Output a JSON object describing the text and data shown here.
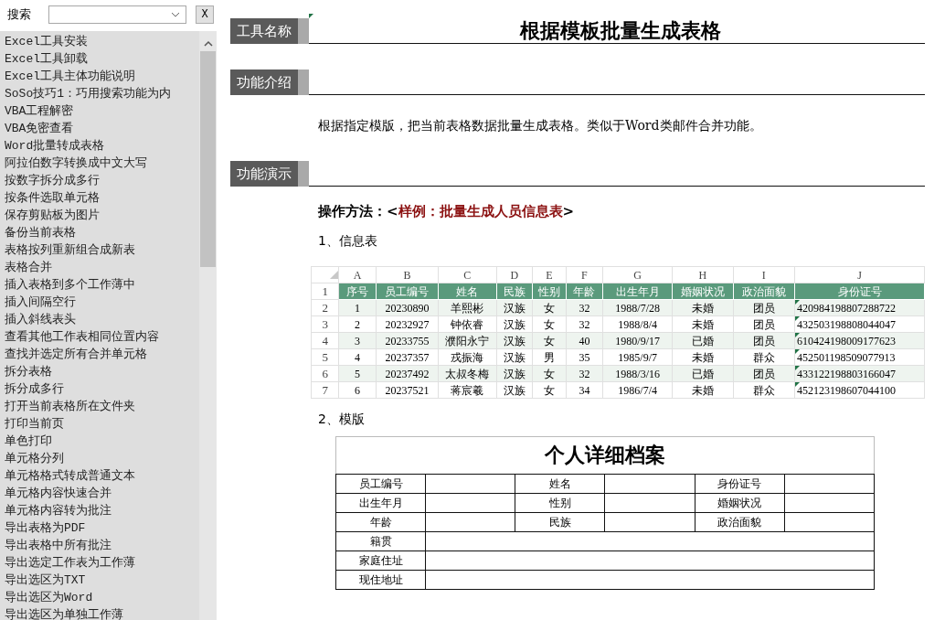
{
  "search": {
    "label": "搜索",
    "clear_button": "X"
  },
  "sidebar": {
    "items": [
      "Excel工具安装",
      "Excel工具卸载",
      "Excel工具主体功能说明",
      "SoSo技巧1：巧用搜索功能为内",
      "VBA工程解密",
      "VBA免密查看",
      "Word批量转成表格",
      "阿拉伯数字转换成中文大写",
      "按数字拆分成多行",
      "按条件选取单元格",
      "保存剪贴板为图片",
      "备份当前表格",
      "表格按列重新组合成新表",
      "表格合并",
      "插入表格到多个工作薄中",
      "插入间隔空行",
      "插入斜线表头",
      "查看其他工作表相同位置内容",
      "查找并选定所有合并单元格",
      "拆分表格",
      "拆分成多行",
      "打开当前表格所在文件夹",
      "打印当前页",
      "单色打印",
      "单元格分列",
      "单元格格式转成普通文本",
      "单元格内容快速合并",
      "单元格内容转为批注",
      "导出表格为PDF",
      "导出表格中所有批注",
      "导出选定工作表为工作薄",
      "导出选区为TXT",
      "导出选区为Word",
      "导出选区为单独工作薄"
    ]
  },
  "sections": [
    {
      "kind": "title",
      "label": "工具名称",
      "title": "根据模板批量生成表格"
    },
    {
      "kind": "intro",
      "label": "功能介绍",
      "text": "根据指定模版，把当前表格数据批量生成表格。类似于Word类邮件合并功能。"
    },
    {
      "kind": "demo",
      "label": "功能演示",
      "method": {
        "prefix": "操作方法：<",
        "highlight": "样例：批量生成人员信息表",
        "suffix": ">"
      },
      "sheet_caption": "1、信息表",
      "sheet": {
        "column_letters": [
          "A",
          "B",
          "C",
          "D",
          "E",
          "F",
          "G",
          "H",
          "I",
          "J"
        ],
        "header": [
          "序号",
          "员工编号",
          "姓名",
          "民族",
          "性别",
          "年龄",
          "出生年月",
          "婚姻状况",
          "政治面貌",
          "身份证号"
        ],
        "row_numbers": [
          "1",
          "2",
          "3",
          "4",
          "5",
          "6",
          "7"
        ],
        "rows": [
          [
            "1",
            "20230890",
            "羊熙彬",
            "汉族",
            "女",
            "32",
            "1988/7/28",
            "未婚",
            "团员",
            "420984198807288722"
          ],
          [
            "2",
            "20232927",
            "钟依睿",
            "汉族",
            "女",
            "32",
            "1988/8/4",
            "未婚",
            "团员",
            "432503198808044047"
          ],
          [
            "3",
            "20233755",
            "濮阳永宁",
            "汉族",
            "女",
            "40",
            "1980/9/17",
            "已婚",
            "团员",
            "610424198009177623"
          ],
          [
            "4",
            "20237357",
            "戎振海",
            "汉族",
            "男",
            "35",
            "1985/9/7",
            "未婚",
            "群众",
            "452501198509077913"
          ],
          [
            "5",
            "20237492",
            "太叔冬梅",
            "汉族",
            "女",
            "32",
            "1988/3/16",
            "已婚",
            "团员",
            "433122198803166047"
          ],
          [
            "6",
            "20237521",
            "蒋宸羲",
            "汉族",
            "女",
            "34",
            "1986/7/4",
            "未婚",
            "群众",
            "452123198607044100"
          ]
        ]
      },
      "template_caption": "2、模版",
      "template": {
        "title": "个人详细档案",
        "rows": [
          [
            "员工编号",
            "姓名",
            "身份证号"
          ],
          [
            "出生年月",
            "性别",
            "婚姻状况"
          ],
          [
            "年龄",
            "民族",
            "政治面貌"
          ],
          [
            "籍贯"
          ],
          [
            "家庭住址"
          ],
          [
            "现住地址"
          ]
        ]
      }
    }
  ]
}
